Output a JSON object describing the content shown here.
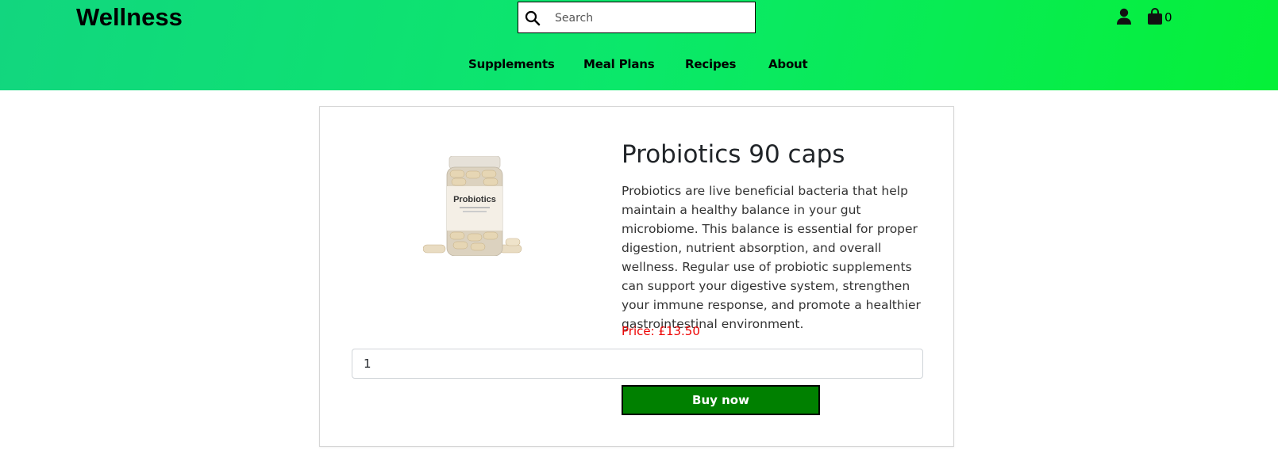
{
  "header": {
    "brand": "Wellness",
    "search": {
      "placeholder": "Search",
      "value": ""
    },
    "icons": {
      "search": "search-icon",
      "user": "user-icon",
      "cart": "shopping-bag-icon"
    },
    "cart_count": "0",
    "gradient_colors": [
      "#12d67f",
      "#05f038"
    ]
  },
  "nav": {
    "items": [
      {
        "label": "Supplements"
      },
      {
        "label": "Meal Plans"
      },
      {
        "label": "Recipes"
      },
      {
        "label": "About"
      }
    ]
  },
  "product": {
    "image_label": "Probiotics",
    "title": "Probiotics 90 caps",
    "description": "Probiotics are live beneficial bacteria that help maintain a healthy balance in your gut microbiome. This balance is essential for proper digestion, nutrient absorption, and overall wellness. Regular use of probiotic supplements can support your digestive system, strengthen your immune response, and promote a healthier gastrointestinal environment.",
    "price": "Price: £13.50",
    "quantity": "1",
    "buy_label": "Buy now",
    "colors": {
      "price": "#ee0000",
      "buy_button": "#008000"
    }
  }
}
